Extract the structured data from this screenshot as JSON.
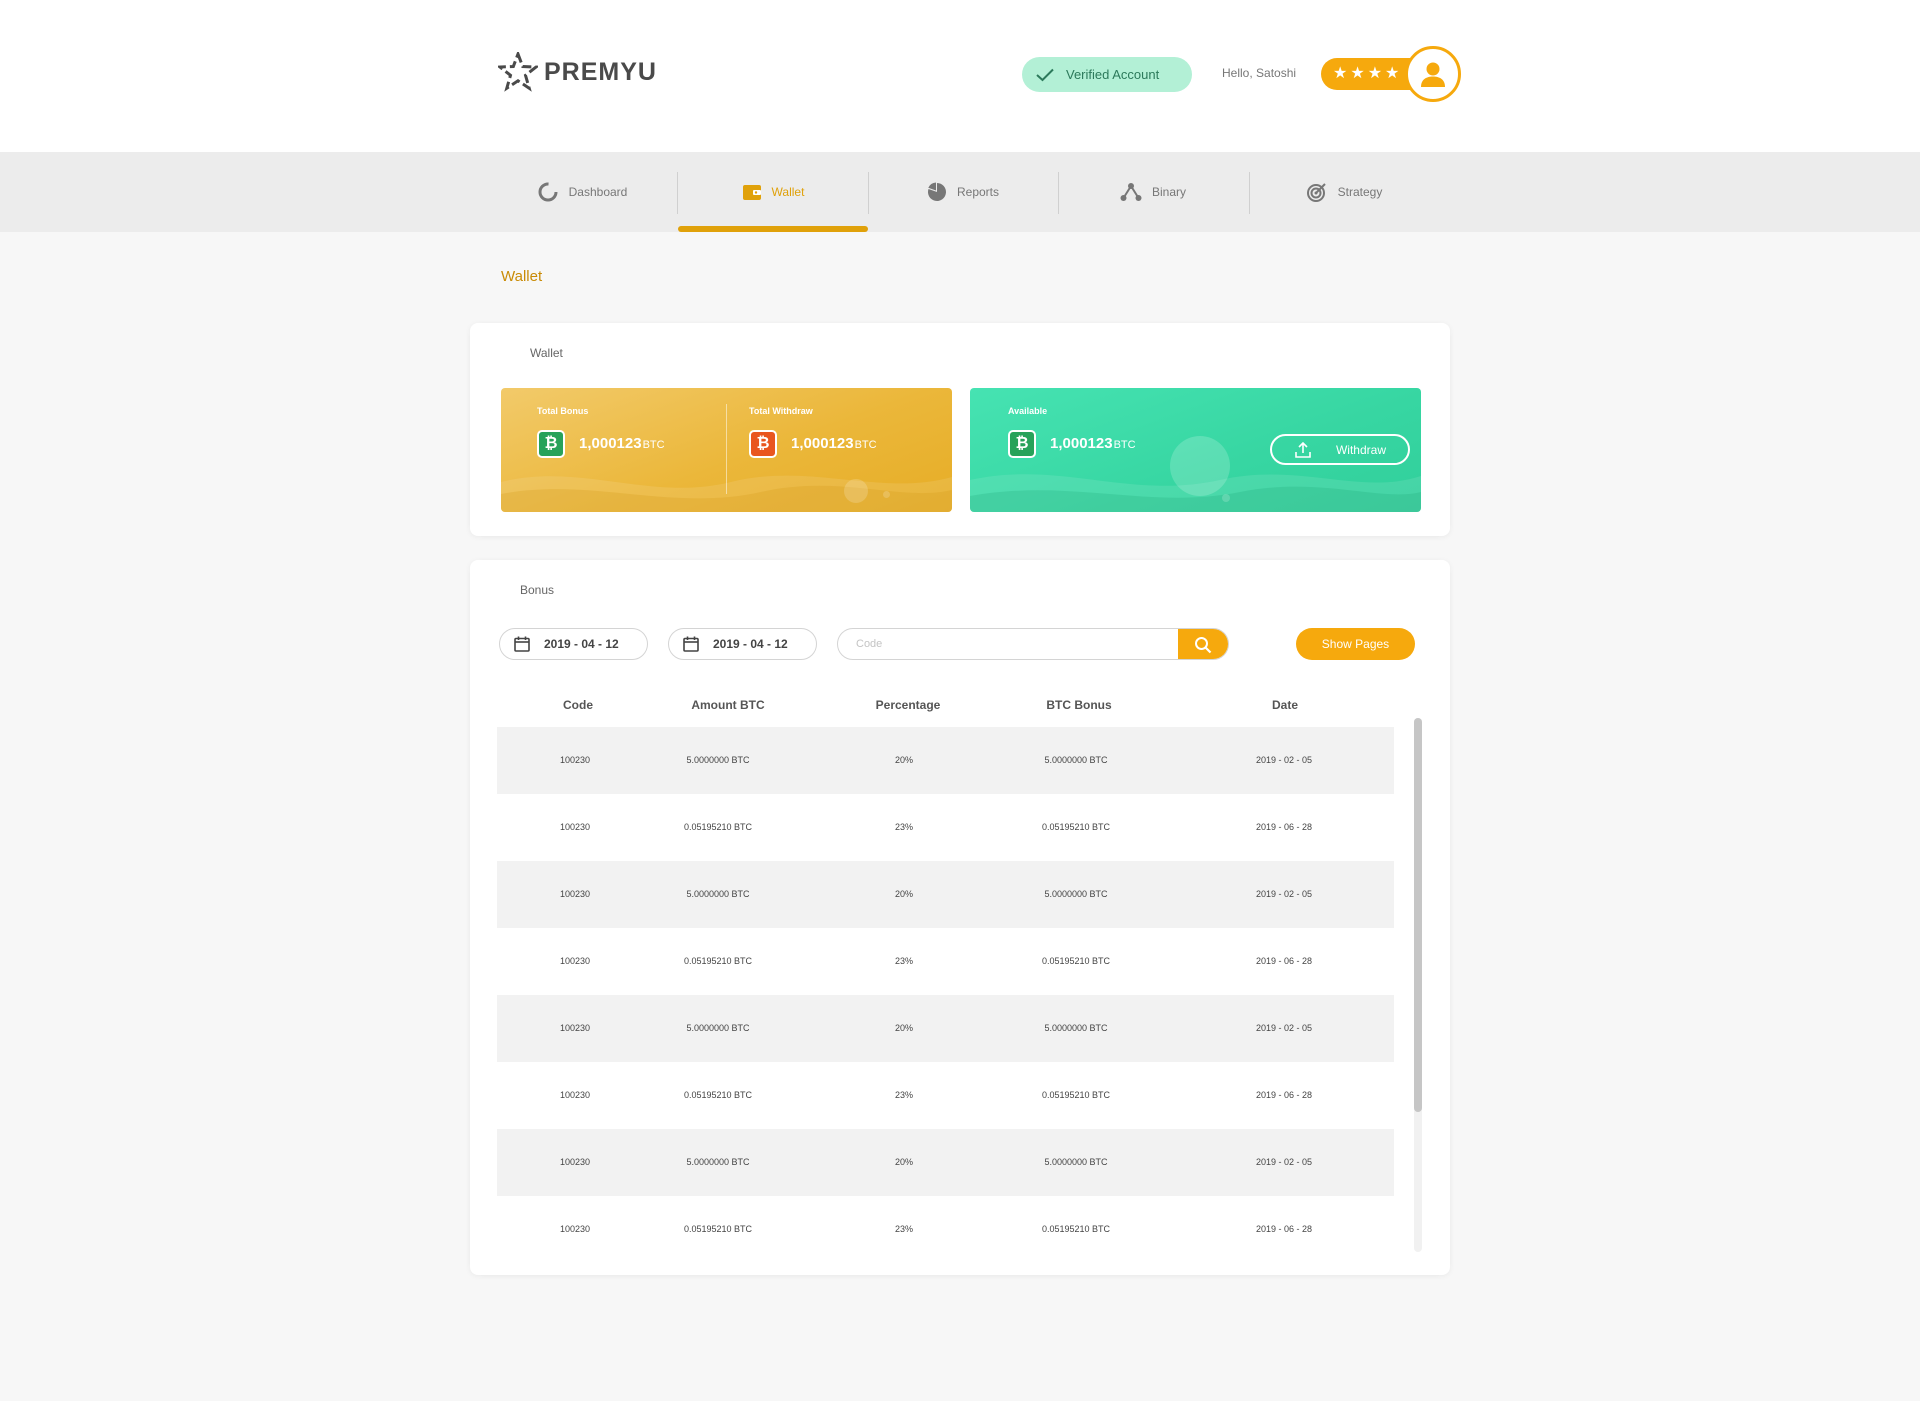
{
  "header": {
    "brand": "PREMYU",
    "verified_label": "Verified Account",
    "greeting": "Hello, Satoshi",
    "rating_stars": 4
  },
  "nav": {
    "items": [
      {
        "label": "Dashboard",
        "icon": "donut-icon"
      },
      {
        "label": "Wallet",
        "icon": "wallet-icon"
      },
      {
        "label": "Reports",
        "icon": "pie-chart-icon"
      },
      {
        "label": "Binary",
        "icon": "binary-tree-icon"
      },
      {
        "label": "Strategy",
        "icon": "target-icon"
      }
    ],
    "active": "Wallet"
  },
  "page_title": "Wallet",
  "wallet_card": {
    "title": "Wallet",
    "total_bonus": {
      "label": "Total Bonus",
      "value": "1,000123",
      "unit": "BTC"
    },
    "total_withdraw": {
      "label": "Total Withdraw",
      "value": "1,000123",
      "unit": "BTC"
    },
    "available": {
      "label": "Available",
      "value": "1,000123",
      "unit": "BTC"
    },
    "withdraw_label": "Withdraw"
  },
  "bonus_card": {
    "title": "Bonus",
    "date_from": "2019 - 04 - 12",
    "date_to": "2019 - 04 - 12",
    "code_placeholder": "Code",
    "show_pages_label": "Show Pages",
    "columns": [
      "Code",
      "Amount BTC",
      "Percentage",
      "BTC Bonus",
      "Date"
    ],
    "rows": [
      [
        "100230",
        "5.0000000 BTC",
        "20%",
        "5.0000000 BTC",
        "2019 - 02 - 05"
      ],
      [
        "100230",
        "0.05195210 BTC",
        "23%",
        "0.05195210 BTC",
        "2019 - 06 - 28"
      ],
      [
        "100230",
        "5.0000000 BTC",
        "20%",
        "5.0000000 BTC",
        "2019 - 02 - 05"
      ],
      [
        "100230",
        "0.05195210 BTC",
        "23%",
        "0.05195210 BTC",
        "2019 - 06 - 28"
      ],
      [
        "100230",
        "5.0000000 BTC",
        "20%",
        "5.0000000 BTC",
        "2019 - 02 - 05"
      ],
      [
        "100230",
        "0.05195210 BTC",
        "23%",
        "0.05195210 BTC",
        "2019 - 06 - 28"
      ],
      [
        "100230",
        "5.0000000 BTC",
        "20%",
        "5.0000000 BTC",
        "2019 - 02 - 05"
      ],
      [
        "100230",
        "0.05195210 BTC",
        "23%",
        "0.05195210 BTC",
        "2019 - 06 - 28"
      ]
    ]
  },
  "colors": {
    "accent": "#f6a90d",
    "gold_panel": "#ebb73a",
    "green_panel": "#37d6a2",
    "verified_bg": "#b3f0d6",
    "btc_green": "#27a25a",
    "btc_orange": "#e9561f"
  }
}
